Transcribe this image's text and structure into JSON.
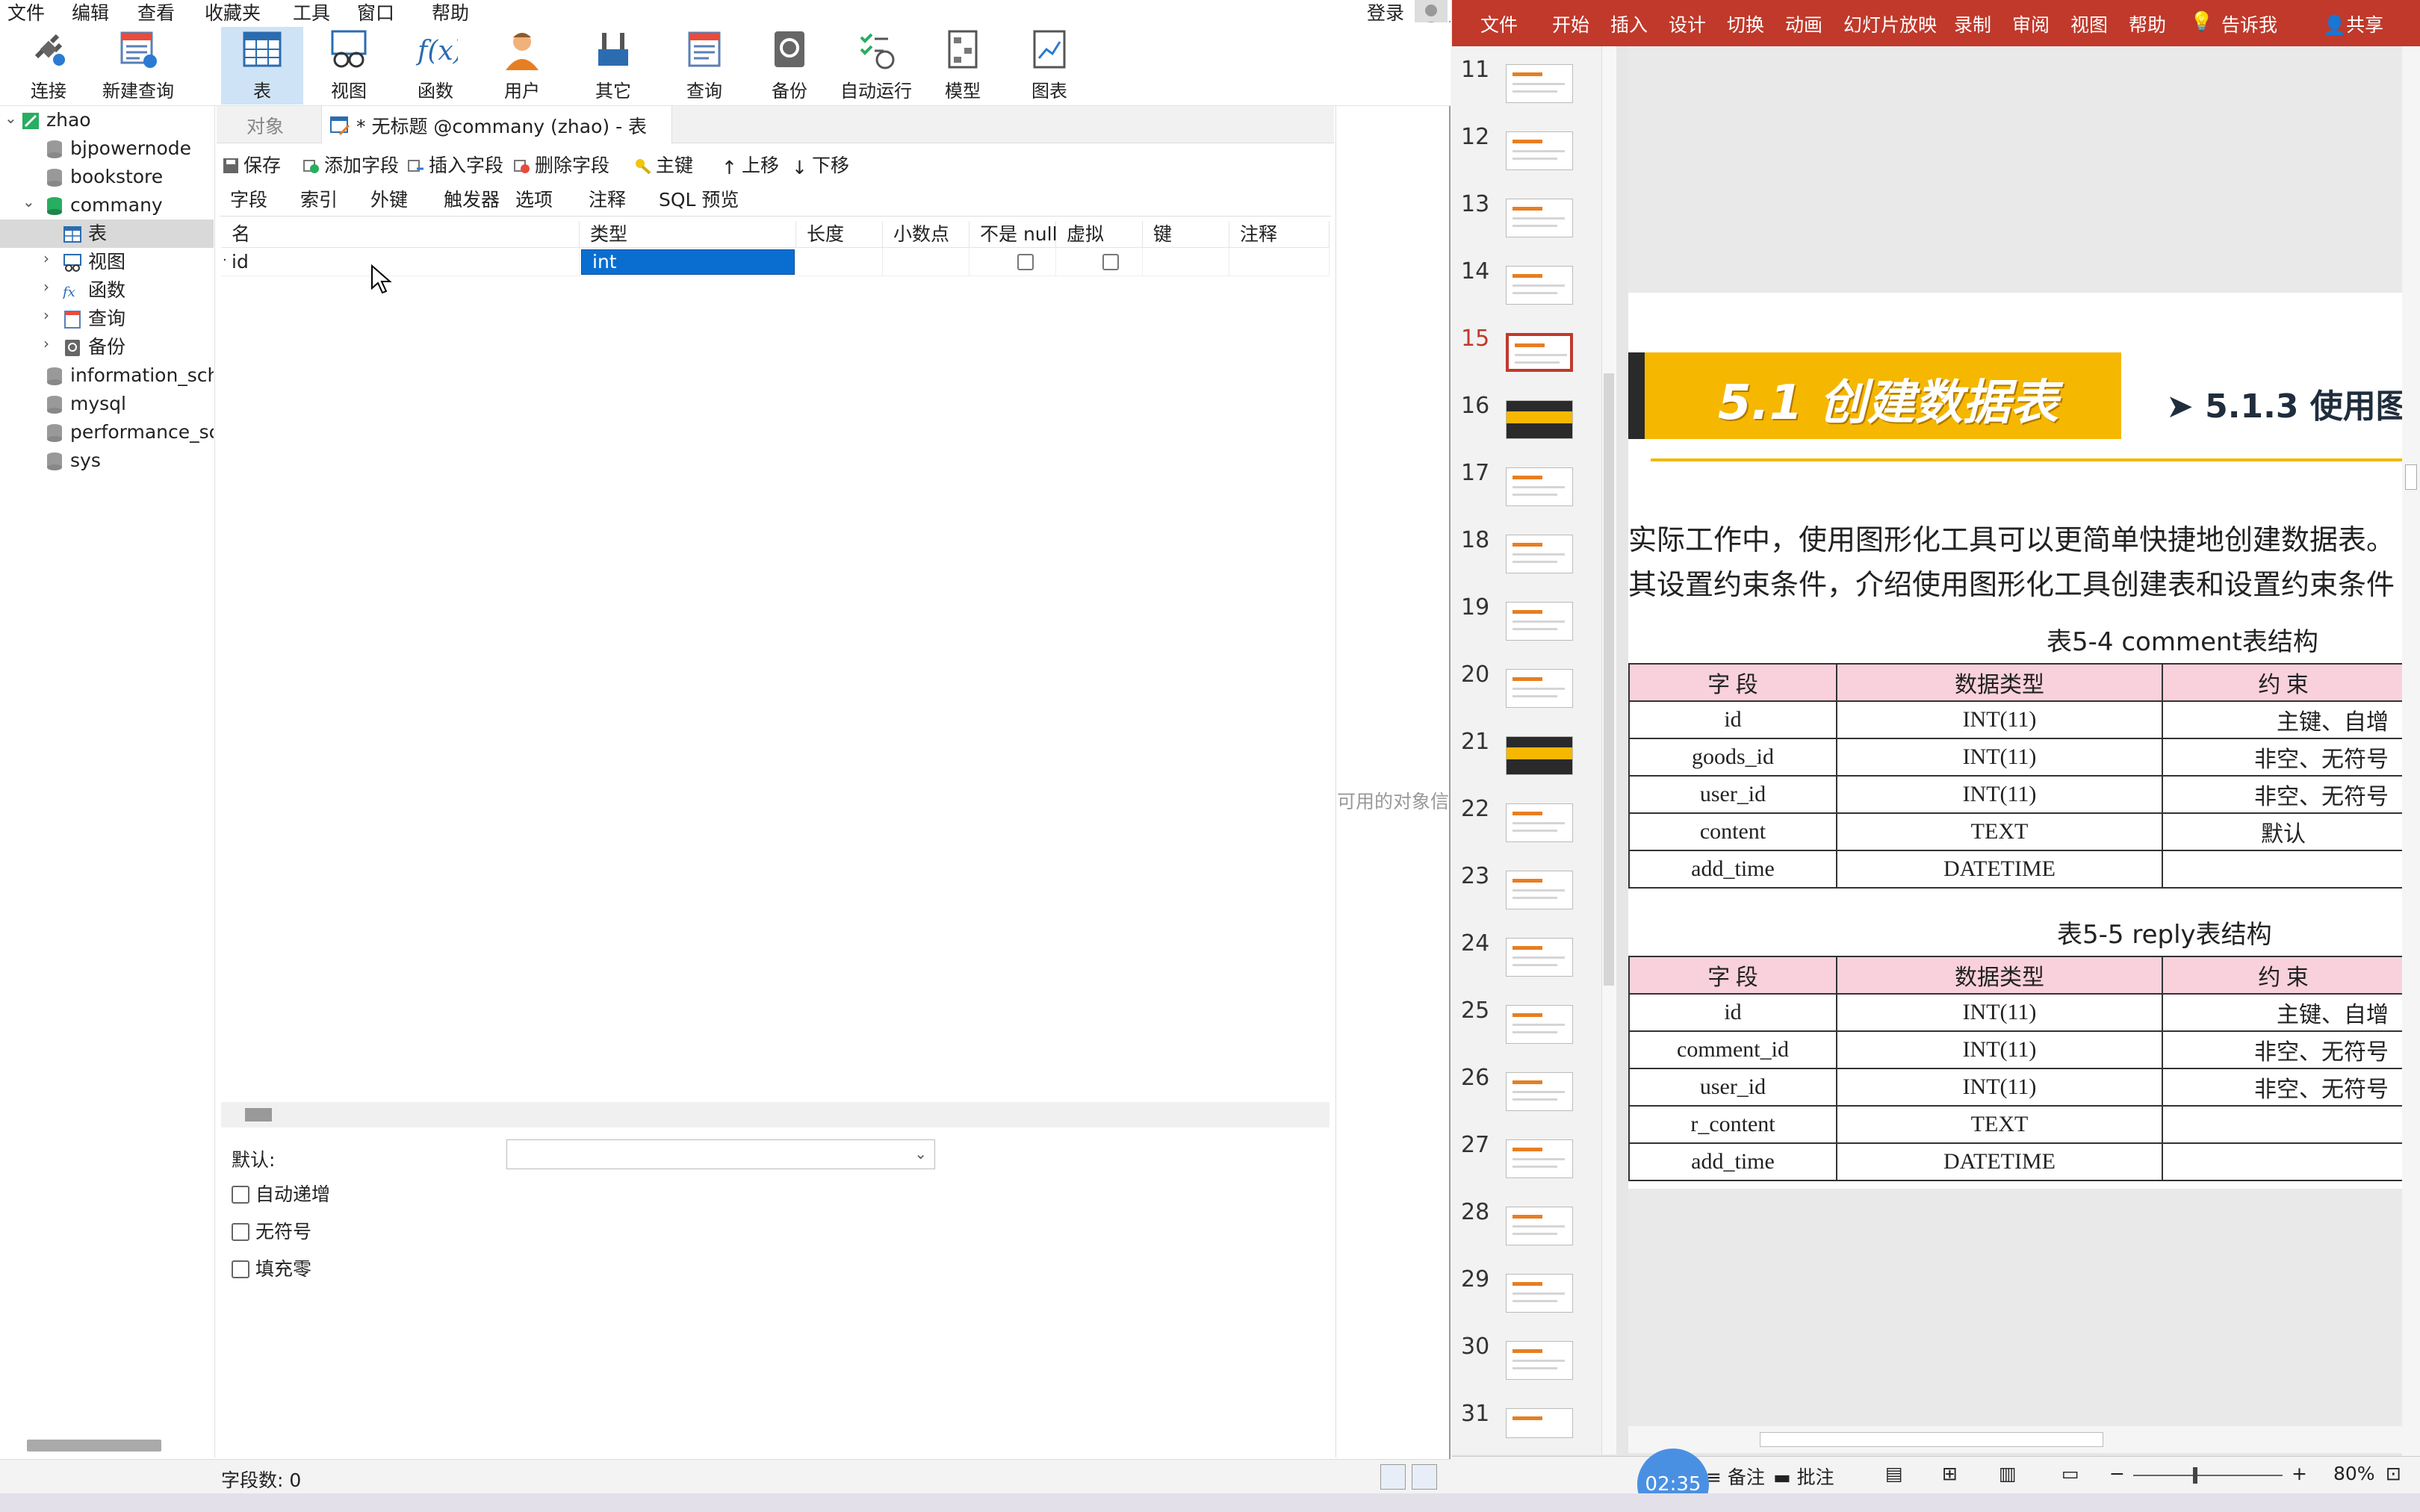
{
  "navicat": {
    "menu": [
      "文件",
      "编辑",
      "查看",
      "收藏夹",
      "工具",
      "窗口",
      "帮助"
    ],
    "login": "登录",
    "toolbar": [
      "连接",
      "新建查询",
      "表",
      "视图",
      "函数",
      "用户",
      "其它",
      "查询",
      "备份",
      "自动运行",
      "模型",
      "图表"
    ],
    "tree": {
      "connection": "zhao",
      "databases": [
        "bjpowernode",
        "bookstore",
        "commany"
      ],
      "commany_children": [
        "表",
        "视图",
        "函数",
        "查询",
        "备份"
      ],
      "other_dbs": [
        "information_sche",
        "mysql",
        "performance_sch",
        "sys"
      ]
    },
    "tabs": {
      "objects": "对象",
      "active": "* 无标题 @commany (zhao) - 表"
    },
    "edit_tools": [
      "保存",
      "添加字段",
      "插入字段",
      "删除字段",
      "主键",
      "上移",
      "下移"
    ],
    "subtabs": [
      "字段",
      "索引",
      "外键",
      "触发器",
      "选项",
      "注释",
      "SQL 预览"
    ],
    "grid": {
      "headers": [
        "名",
        "类型",
        "长度",
        "小数点",
        "不是 null",
        "虚拟",
        "键",
        "注释"
      ],
      "row": {
        "name": "id",
        "type": "int"
      }
    },
    "props": {
      "default_label": "默认:",
      "options": [
        "自动递增",
        "无符号",
        "填充零"
      ]
    },
    "side_text": "可用的对象信",
    "status": "字段数: 0"
  },
  "ppt": {
    "ribbon": [
      "文件",
      "开始",
      "插入",
      "设计",
      "切换",
      "动画",
      "幻灯片放映",
      "录制",
      "审阅",
      "视图",
      "帮助",
      "告诉我",
      "共享"
    ],
    "slide_numbers": [
      "11",
      "12",
      "13",
      "14",
      "15",
      "16",
      "17",
      "18",
      "19",
      "20",
      "21",
      "22",
      "23",
      "24",
      "25",
      "26",
      "27",
      "28",
      "29",
      "30",
      "31"
    ],
    "current_slide": "15",
    "slide": {
      "banner": "5.1  创建数据表",
      "subhead": "➤  5.1.3  使用图",
      "para1": "实际工作中，使用图形化工具可以更简单快捷地创建数据表。",
      "para2": "其设置约束条件，介绍使用图形化工具创建表和设置约束条件",
      "table1": {
        "caption": "表5-4  comment表结构",
        "headers": [
          "字 段",
          "数据类型",
          "约 束"
        ],
        "rows": [
          [
            "id",
            "INT(11)",
            "主键、自增"
          ],
          [
            "goods_id",
            "INT(11)",
            "非空、无符号"
          ],
          [
            "user_id",
            "INT(11)",
            "非空、无符号"
          ],
          [
            "content",
            "TEXT",
            "默认"
          ],
          [
            "add_time",
            "DATETIME",
            ""
          ]
        ]
      },
      "table2": {
        "caption": "表5-5  reply表结构",
        "headers": [
          "字 段",
          "数据类型",
          "约 束"
        ],
        "rows": [
          [
            "id",
            "INT(11)",
            "主键、自增"
          ],
          [
            "comment_id",
            "INT(11)",
            "非空、无符号"
          ],
          [
            "user_id",
            "INT(11)",
            "非空、无符号"
          ],
          [
            "r_content",
            "TEXT",
            ""
          ],
          [
            "add_time",
            "DATETIME",
            ""
          ]
        ]
      }
    },
    "status": {
      "notes": "备注",
      "comments": "批注",
      "zoom": "80%",
      "timer": "02:35"
    }
  }
}
